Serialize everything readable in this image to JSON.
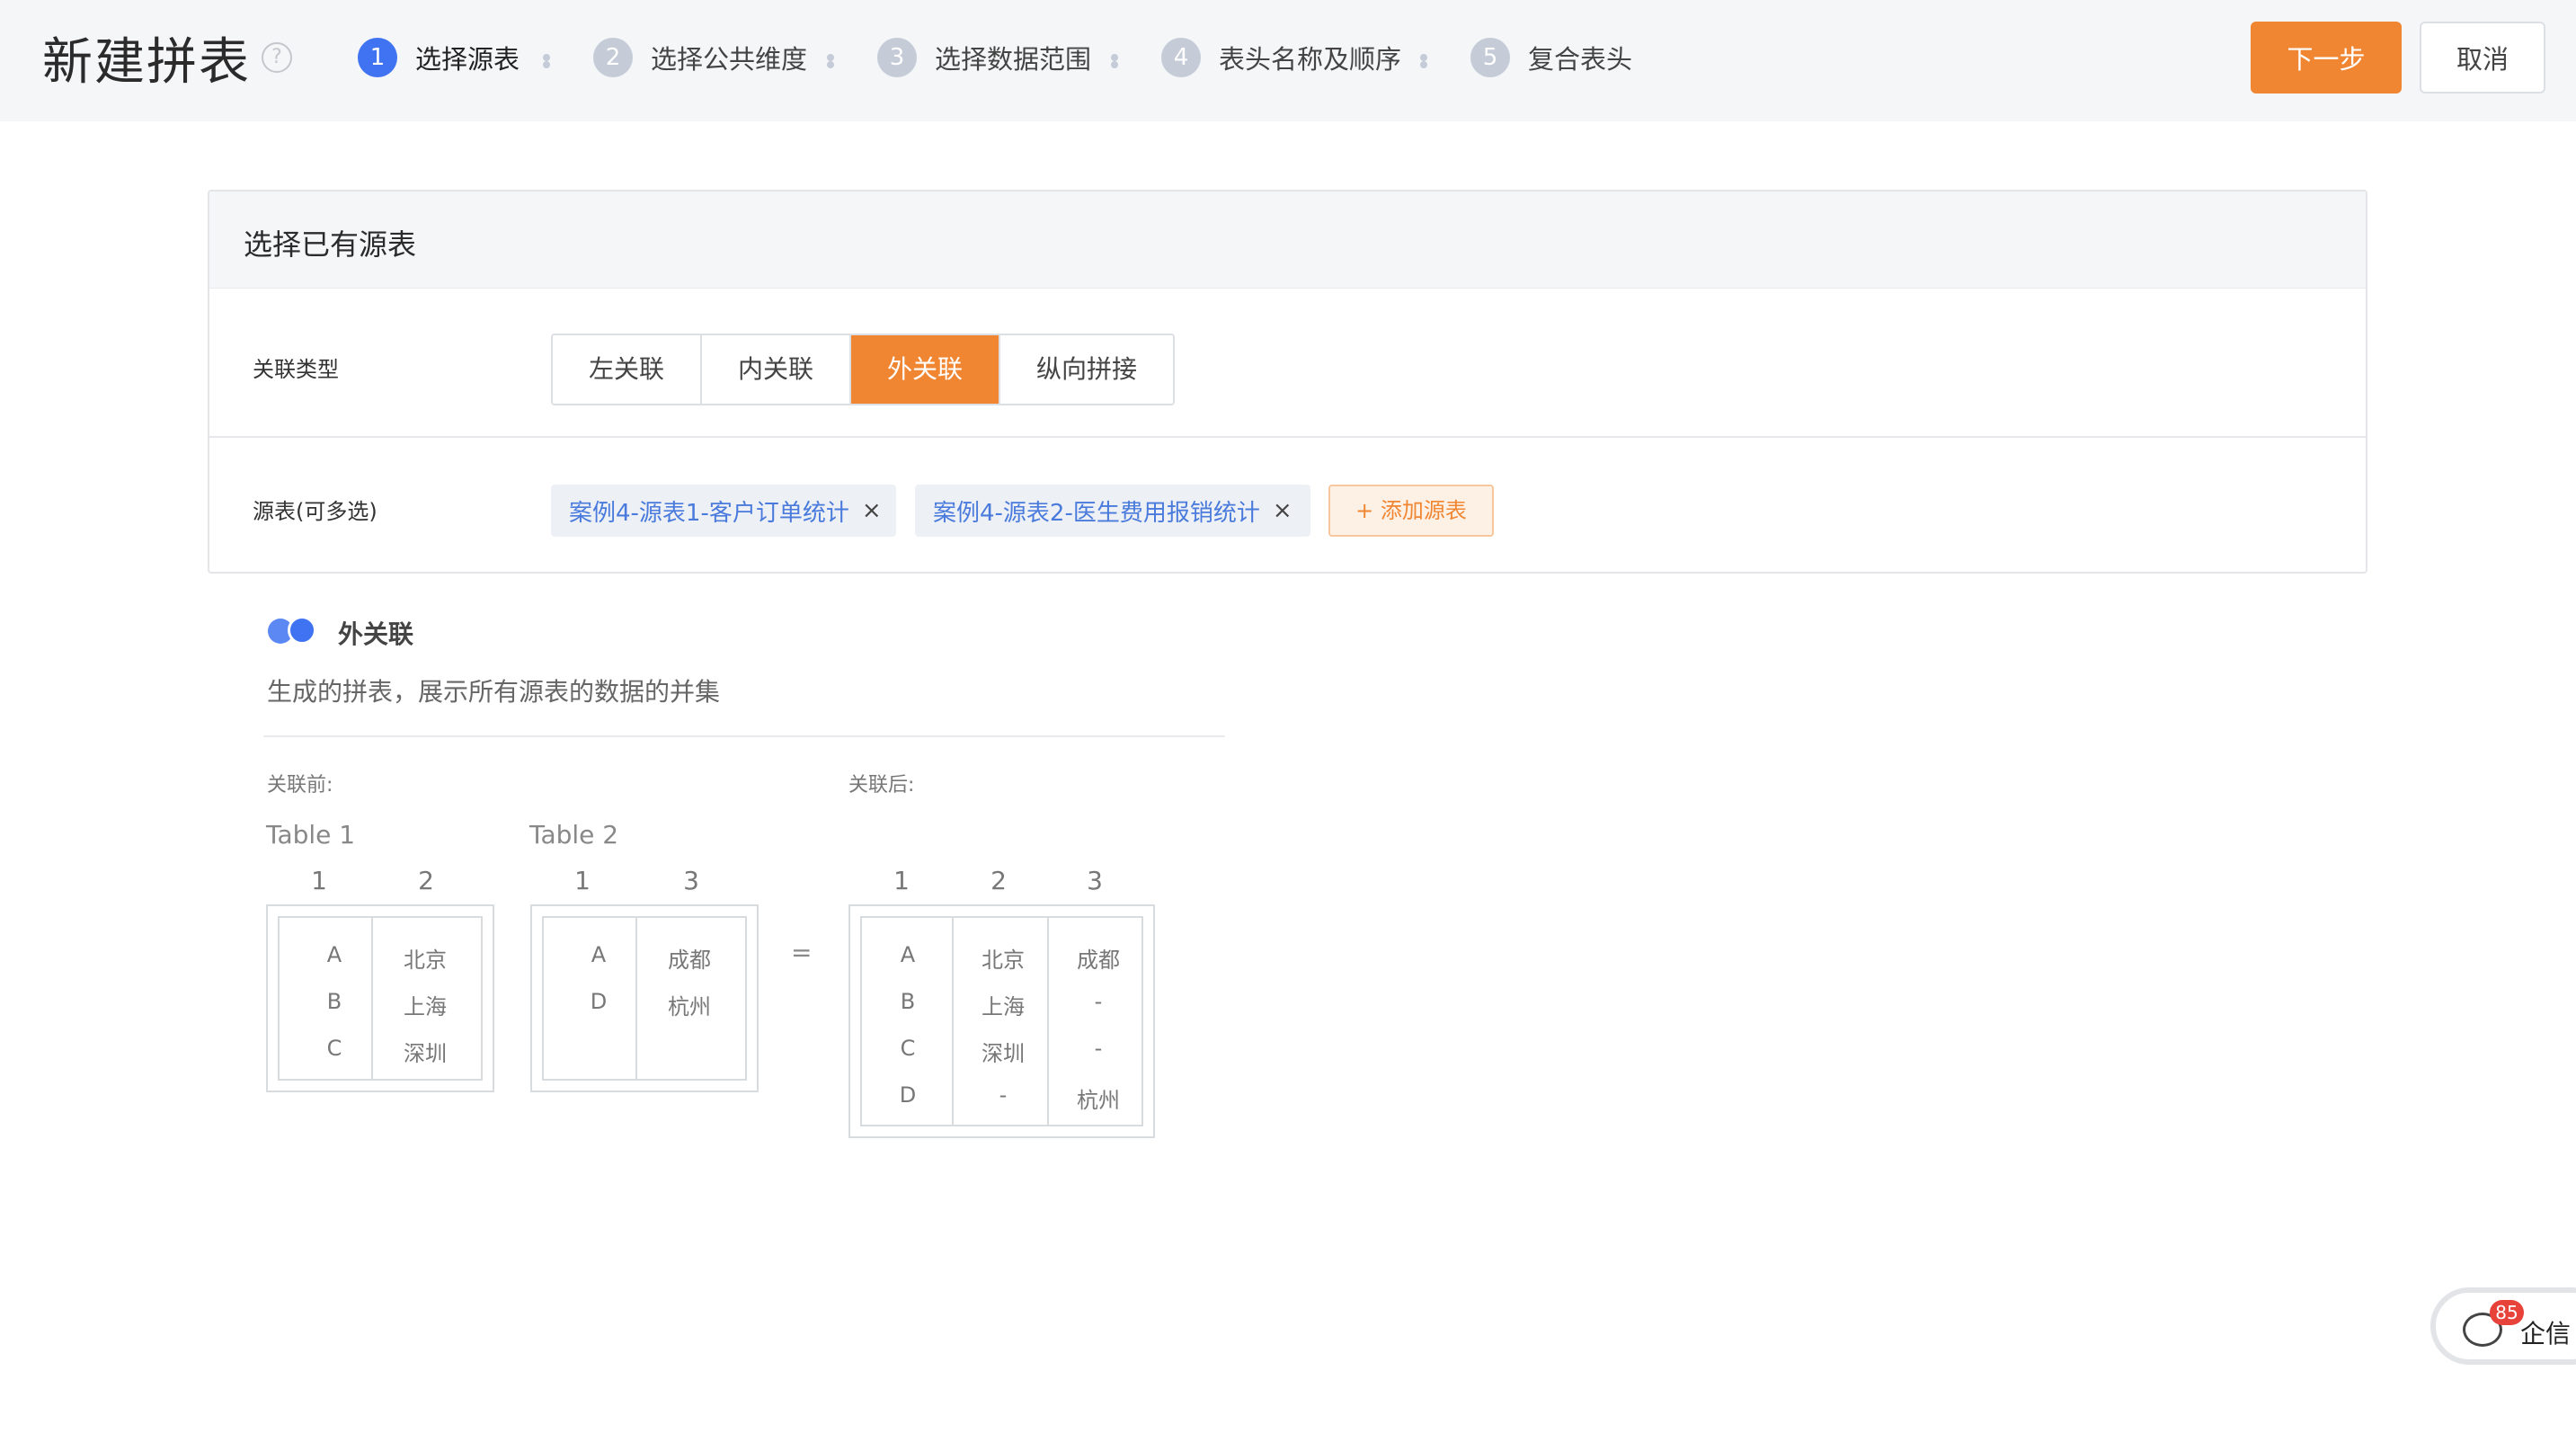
{
  "header": {
    "title": "新建拼表",
    "help_icon": "?",
    "steps": [
      {
        "num": "1",
        "label": "选择源表"
      },
      {
        "num": "2",
        "label": "选择公共维度"
      },
      {
        "num": "3",
        "label": "选择数据范围"
      },
      {
        "num": "4",
        "label": "表头名称及顺序"
      },
      {
        "num": "5",
        "label": "复合表头"
      }
    ],
    "next_label": "下一步",
    "cancel_label": "取消"
  },
  "panel": {
    "title": "选择已有源表",
    "join_type_label": "关联类型",
    "join_types": [
      "左关联",
      "内关联",
      "外关联",
      "纵向拼接"
    ],
    "selected_join_type": "外关联",
    "source_label": "源表(可多选)",
    "source_tags": [
      "案例4-源表1-客户订单统计",
      "案例4-源表2-医生费用报销统计"
    ],
    "tag_close": "×",
    "add_source_label": "+ 添加源表"
  },
  "description": {
    "title": "外关联",
    "text": "生成的拼表，展示所有源表的数据的并集",
    "before_label": "关联前:",
    "after_label": "关联后:",
    "equals": "=",
    "table1": {
      "title": "Table 1",
      "headers": [
        "1",
        "2"
      ],
      "col1": [
        "A",
        "B",
        "C"
      ],
      "col2": [
        "北京",
        "上海",
        "深圳"
      ]
    },
    "table2": {
      "title": "Table 2",
      "headers": [
        "1",
        "3"
      ],
      "col1": [
        "A",
        "D"
      ],
      "col2": [
        "成都",
        "杭州"
      ]
    },
    "result": {
      "headers": [
        "1",
        "2",
        "3"
      ],
      "col1": [
        "A",
        "B",
        "C",
        "D"
      ],
      "col2": [
        "北京",
        "上海",
        "深圳",
        "-"
      ],
      "col3": [
        "成都",
        "-",
        "-",
        "杭州"
      ]
    }
  },
  "chat_widget": {
    "badge": "85",
    "label": "企信"
  },
  "colors": {
    "accent": "#f08632",
    "primary": "#3f73f1",
    "tag_text": "#4a7bdc"
  }
}
